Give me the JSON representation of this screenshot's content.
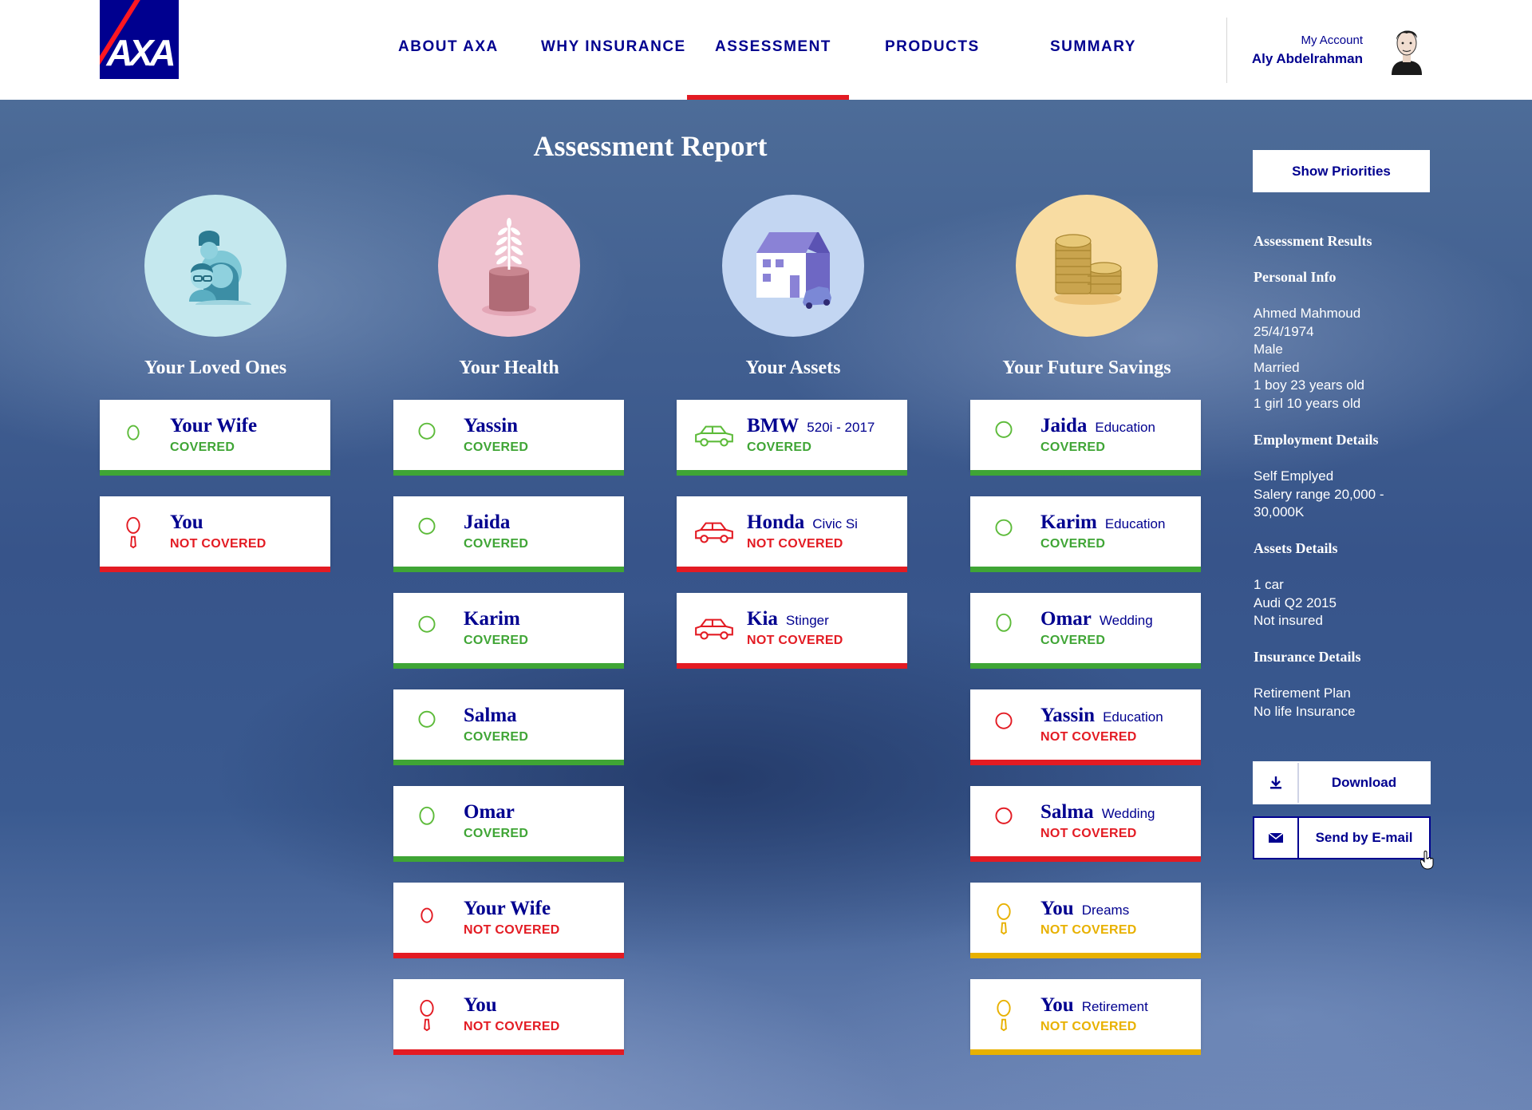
{
  "brand": {
    "logo_text": "AXA",
    "primary_color": "#00008f",
    "accent_color": "#e31b23"
  },
  "nav": {
    "items": [
      {
        "label": "ABOUT AXA"
      },
      {
        "label": "WHY INSURANCE"
      },
      {
        "label": "ASSESSMENT",
        "active": true
      },
      {
        "label": "PRODUCTS"
      },
      {
        "label": "SUMMARY"
      }
    ]
  },
  "account": {
    "label": "My Account",
    "name": "Aly Abdelrahman"
  },
  "page": {
    "title": "Assessment Report"
  },
  "status_colors": {
    "covered": "#3fa535",
    "not_covered": "#e31b23",
    "warning": "#e8b100"
  },
  "categories": [
    {
      "title": "Your Loved Ones",
      "icon": "family-icon",
      "cards": [
        {
          "name": "Your Wife",
          "sub": "",
          "status": "COVERED",
          "state": "covered",
          "icon": "woman-icon"
        },
        {
          "name": "You",
          "sub": "",
          "status": "NOT COVERED",
          "state": "not_covered",
          "icon": "man-tie-icon"
        }
      ]
    },
    {
      "title": "Your Health",
      "icon": "plant-pot-icon",
      "cards": [
        {
          "name": "Yassin",
          "sub": "",
          "status": "COVERED",
          "state": "covered",
          "icon": "boy-icon"
        },
        {
          "name": "Jaida",
          "sub": "",
          "status": "COVERED",
          "state": "covered",
          "icon": "girl-icon"
        },
        {
          "name": "Karim",
          "sub": "",
          "status": "COVERED",
          "state": "covered",
          "icon": "boy-icon"
        },
        {
          "name": "Salma",
          "sub": "",
          "status": "COVERED",
          "state": "covered",
          "icon": "girl-icon"
        },
        {
          "name": "Omar",
          "sub": "",
          "status": "COVERED",
          "state": "covered",
          "icon": "man-icon"
        },
        {
          "name": "Your Wife",
          "sub": "",
          "status": "NOT COVERED",
          "state": "not_covered",
          "icon": "woman-icon"
        },
        {
          "name": "You",
          "sub": "",
          "status": "NOT COVERED",
          "state": "not_covered",
          "icon": "man-tie-icon"
        }
      ]
    },
    {
      "title": "Your Assets",
      "icon": "house-car-icon",
      "cards": [
        {
          "name": "BMW",
          "sub": "520i - 2017",
          "status": "COVERED",
          "state": "covered",
          "icon": "car-icon"
        },
        {
          "name": "Honda",
          "sub": "Civic Si",
          "status": "NOT COVERED",
          "state": "not_covered",
          "icon": "car-icon"
        },
        {
          "name": "Kia",
          "sub": "Stinger",
          "status": "NOT COVERED",
          "state": "not_covered",
          "icon": "car-icon"
        }
      ]
    },
    {
      "title": "Your Future Savings",
      "icon": "coins-icon",
      "cards": [
        {
          "name": "Jaida",
          "sub": "Education",
          "status": "COVERED",
          "state": "covered",
          "icon": "girl-icon"
        },
        {
          "name": "Karim",
          "sub": "Education",
          "status": "COVERED",
          "state": "covered",
          "icon": "boy-icon"
        },
        {
          "name": "Omar",
          "sub": "Wedding",
          "status": "COVERED",
          "state": "covered",
          "icon": "man-icon"
        },
        {
          "name": "Yassin",
          "sub": "Education",
          "status": "NOT COVERED",
          "state": "not_covered",
          "icon": "boy-icon"
        },
        {
          "name": "Salma",
          "sub": "Wedding",
          "status": "NOT COVERED",
          "state": "not_covered",
          "icon": "girl-icon"
        },
        {
          "name": "You",
          "sub": "Dreams",
          "status": "NOT COVERED",
          "state": "warning",
          "icon": "man-tie-icon"
        },
        {
          "name": "You",
          "sub": "Retirement",
          "status": "NOT COVERED",
          "state": "warning",
          "icon": "man-tie-icon"
        }
      ]
    }
  ],
  "sidebar": {
    "show_priorities": "Show Priorities",
    "results_title": "Assessment Results",
    "personal_title": "Personal Info",
    "personal_lines": [
      "Ahmed Mahmoud",
      "25/4/1974",
      "Male",
      "Married",
      "1 boy 23 years old",
      "1 girl 10 years old"
    ],
    "employment_title": "Employment Details",
    "employment_lines": [
      "Self Emplyed",
      "Salery range 20,000 -",
      "30,000K"
    ],
    "assets_title": "Assets Details",
    "assets_lines": [
      "1 car",
      "Audi Q2 2015",
      "Not insured"
    ],
    "insurance_title": "Insurance Details",
    "insurance_lines": [
      "Retirement Plan",
      "No life Insurance"
    ],
    "download_label": "Download",
    "email_label": "Send by E-mail"
  }
}
